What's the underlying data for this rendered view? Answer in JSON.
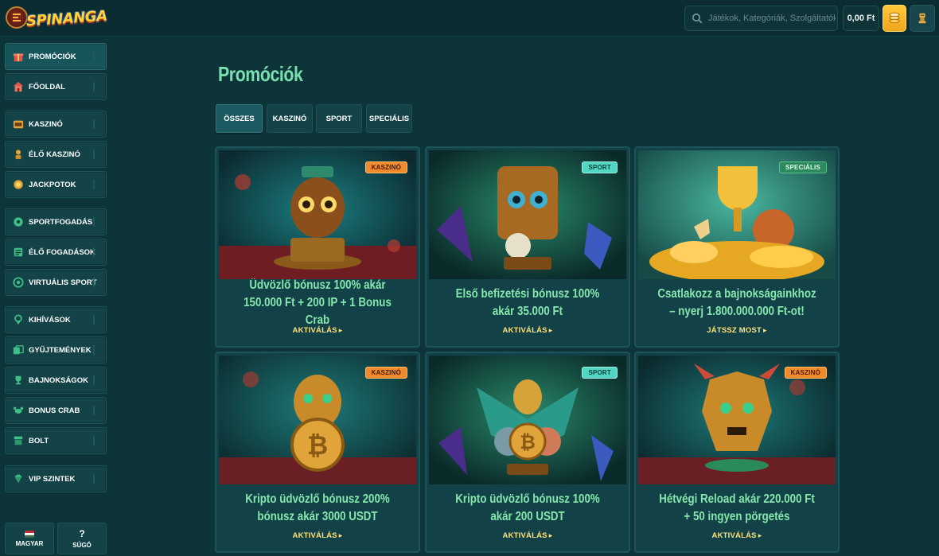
{
  "header": {
    "logo_text": "SPINANGA",
    "search_placeholder": "Játékok, Kategóriák, Szolgáltatók",
    "balance": "0,00 Ft"
  },
  "sidebar": {
    "items": [
      {
        "label": "PROMÓCIÓK",
        "icon": "gift-icon"
      },
      {
        "label": "FŐOLDAL",
        "icon": "home-icon"
      },
      {
        "label": "KASZINÓ",
        "icon": "casino-icon"
      },
      {
        "label": "ÉLŐ KASZINÓ",
        "icon": "dealer-icon"
      },
      {
        "label": "JACKPOTOK",
        "icon": "jackpot-icon"
      },
      {
        "label": "SPORTFOGADÁS",
        "icon": "ball-icon"
      },
      {
        "label": "ÉLŐ FOGADÁSOK",
        "icon": "live-bet-icon"
      },
      {
        "label": "VIRTUÁLIS SPORT",
        "icon": "virtual-sport-icon"
      },
      {
        "label": "KIHÍVÁSOK",
        "icon": "challenge-icon"
      },
      {
        "label": "GYŰJTEMÉNYEK",
        "icon": "collection-icon"
      },
      {
        "label": "BAJNOKSÁGOK",
        "icon": "trophy-icon"
      },
      {
        "label": "BONUS CRAB",
        "icon": "crab-icon"
      },
      {
        "label": "BOLT",
        "icon": "shop-icon"
      },
      {
        "label": "VIP SZINTEK",
        "icon": "diamond-icon"
      }
    ],
    "language_label": "MAGYAR",
    "help_label": "SÚGÓ"
  },
  "main": {
    "title": "Promóciók",
    "tabs": [
      {
        "label": "ÖSSZES"
      },
      {
        "label": "KASZINÓ"
      },
      {
        "label": "SPORT"
      },
      {
        "label": "SPECIÁLIS"
      }
    ],
    "cards": [
      {
        "badge": "KASZINÓ",
        "title": "Üdvözlő bónusz 100% akár 150.000 Ft + 200 IP + 1 Bonus Crab",
        "cta": "AKTIVÁLÁS"
      },
      {
        "badge": "SPORT",
        "title": "Első befizetési bónusz 100% akár 35.000 Ft",
        "cta": "AKTIVÁLÁS"
      },
      {
        "badge": "SPECIÁLIS",
        "title": "Csatlakozz a bajnokságainkhoz – nyerj 1.800.000.000 Ft-ot!",
        "cta": "JÁTSSZ MOST"
      },
      {
        "badge": "KASZINÓ",
        "title": "Kripto üdvözlő bónusz 200% bónusz akár 3000 USDT",
        "cta": "AKTIVÁLÁS"
      },
      {
        "badge": "SPORT",
        "title": "Kripto üdvözlő bónusz 100% akár 200 USDT",
        "cta": "AKTIVÁLÁS"
      },
      {
        "badge": "KASZINÓ",
        "title": "Hétvégi Reload akár 220.000 Ft + 50 ingyen pörgetés",
        "cta": "AKTIVÁLÁS"
      }
    ]
  },
  "colors": {
    "background": "#0d3438",
    "accent_green": "#86e6ad",
    "cta_yellow": "#ffe07a",
    "badge_casino": "#f08a2a",
    "badge_sport": "#50d6c2",
    "badge_special": "#2d8a5e"
  }
}
